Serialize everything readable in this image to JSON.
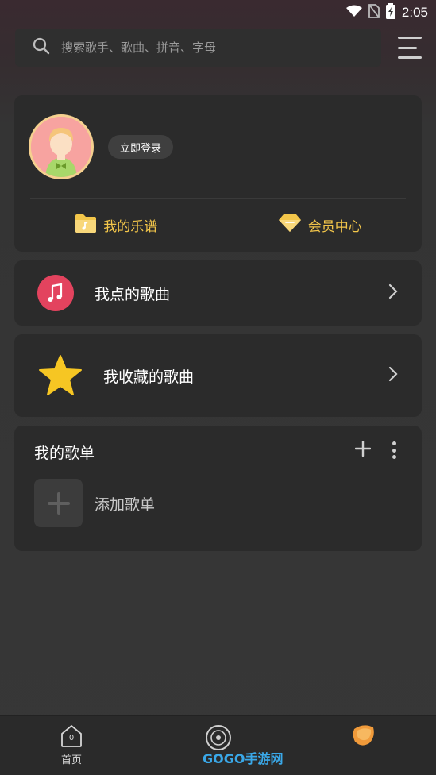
{
  "status_bar": {
    "time": "2:05"
  },
  "search": {
    "placeholder": "搜索歌手、歌曲、拼音、字母"
  },
  "profile": {
    "login_label": "立即登录",
    "my_sheets_label": "我的乐谱",
    "vip_label": "会员中心"
  },
  "rows": {
    "requested_songs": "我点的歌曲",
    "favorite_songs": "我收藏的歌曲"
  },
  "playlists": {
    "title": "我的歌单",
    "add_label": "添加歌单"
  },
  "tabbar": {
    "home_label": "首页",
    "home_badge": "0",
    "watermark": "GOGO手游网"
  },
  "colors": {
    "accent_gold": "#f3c64a",
    "music_icon_red": "#e3435e",
    "star_yellow": "#f6c623"
  },
  "icons": [
    "wifi-icon",
    "no-sim-icon",
    "battery-icon",
    "search-icon",
    "menu-icon",
    "folder-icon",
    "diamond-icon",
    "music-note-icon",
    "star-icon",
    "chevron-right-icon",
    "plus-icon",
    "more-vertical-icon",
    "home-icon",
    "record-icon",
    "orange-logo-icon"
  ]
}
